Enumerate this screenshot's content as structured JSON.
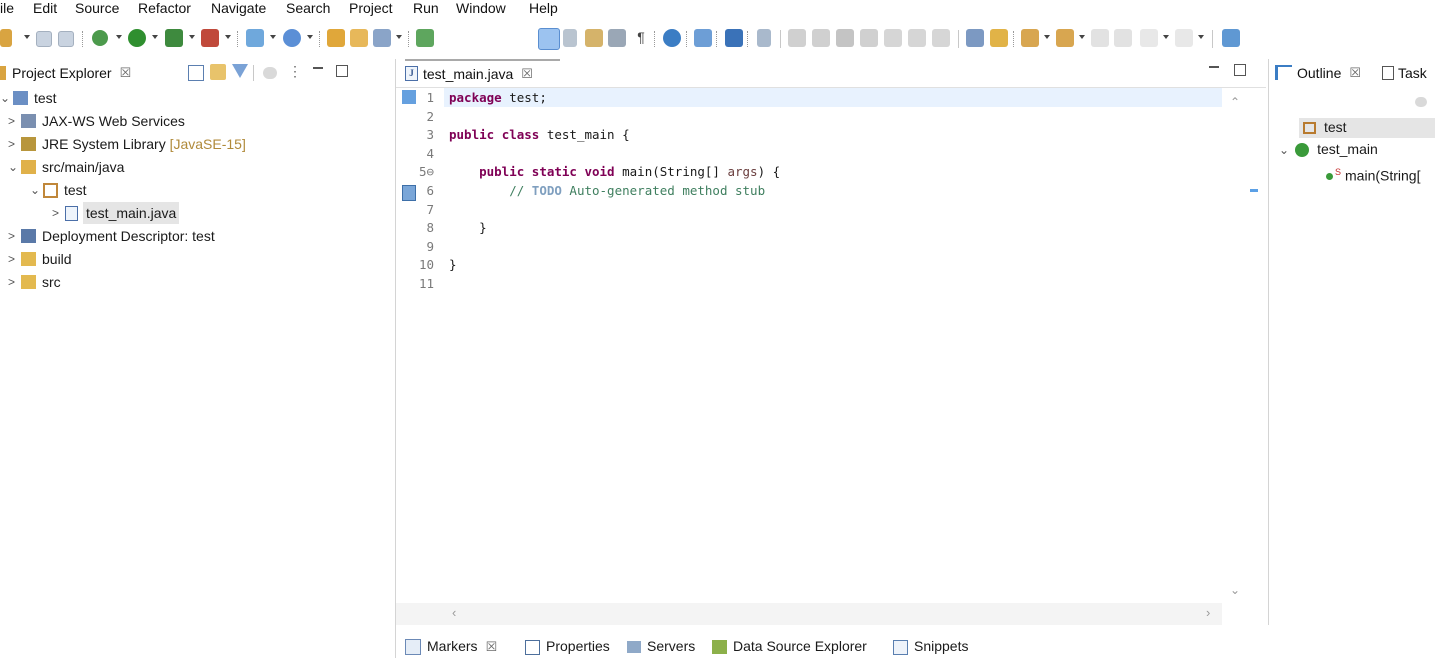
{
  "menu": [
    "ile",
    "Edit",
    "Source",
    "Refactor",
    "Navigate",
    "Search",
    "Project",
    "Run",
    "Window",
    "Help"
  ],
  "project_explorer": {
    "title": "Project Explorer",
    "close": "☒",
    "tree": [
      {
        "label": "test",
        "twisty": "⌄",
        "icon": "project-icon",
        "level": 0
      },
      {
        "label": "JAX-WS Web Services",
        "twisty": ">",
        "icon": "web-services-icon",
        "level": 1
      },
      {
        "label": "JRE System Library",
        "decoration": "[JavaSE-15]",
        "twisty": ">",
        "icon": "library-icon",
        "level": 1
      },
      {
        "label": "src/main/java",
        "twisty": "⌄",
        "icon": "source-folder-icon",
        "level": 1
      },
      {
        "label": "test",
        "twisty": "⌄",
        "icon": "package-icon",
        "level": 2
      },
      {
        "label": "test_main.java",
        "twisty": ">",
        "icon": "java-file-icon",
        "level": 3,
        "selected": true
      },
      {
        "label": "Deployment Descriptor: test",
        "twisty": ">",
        "icon": "deployment-descriptor-icon",
        "level": 1
      },
      {
        "label": "build",
        "twisty": ">",
        "icon": "folder-icon",
        "level": 1
      },
      {
        "label": "src",
        "twisty": ">",
        "icon": "folder-icon",
        "level": 1
      }
    ]
  },
  "editor": {
    "tab_label": "test_main.java",
    "close": "☒",
    "lines": [
      {
        "n": "1",
        "parts": [
          {
            "t": "package",
            "c": "kw"
          },
          {
            "t": " test;",
            "c": ""
          }
        ]
      },
      {
        "n": "2",
        "parts": []
      },
      {
        "n": "3",
        "parts": [
          {
            "t": "public",
            "c": "kw"
          },
          {
            "t": " ",
            "c": ""
          },
          {
            "t": "class",
            "c": "kw"
          },
          {
            "t": " test_main {",
            "c": ""
          }
        ]
      },
      {
        "n": "4",
        "parts": []
      },
      {
        "n": "5⊖",
        "parts": [
          {
            "t": "    ",
            "c": ""
          },
          {
            "t": "public",
            "c": "kw"
          },
          {
            "t": " ",
            "c": ""
          },
          {
            "t": "static",
            "c": "kw"
          },
          {
            "t": " ",
            "c": ""
          },
          {
            "t": "void",
            "c": "kw"
          },
          {
            "t": " main(String[] ",
            "c": ""
          },
          {
            "t": "args",
            "c": "ident"
          },
          {
            "t": ") {",
            "c": ""
          }
        ]
      },
      {
        "n": "6",
        "parts": [
          {
            "t": "        // ",
            "c": "cm"
          },
          {
            "t": "TODO",
            "c": "todo"
          },
          {
            "t": " Auto-generated method stub",
            "c": "cm"
          }
        ]
      },
      {
        "n": "7",
        "parts": []
      },
      {
        "n": "8",
        "parts": [
          {
            "t": "    }",
            "c": ""
          }
        ]
      },
      {
        "n": "9",
        "parts": []
      },
      {
        "n": "10",
        "parts": [
          {
            "t": "}",
            "c": ""
          }
        ]
      },
      {
        "n": "11",
        "parts": []
      }
    ]
  },
  "outline": {
    "title": "Outline",
    "close": "☒",
    "second_tab": "Task",
    "items": [
      {
        "label": "test",
        "icon": "package-icon"
      },
      {
        "label": "test_main",
        "icon": "class-icon",
        "twisty": "⌄"
      },
      {
        "label": "main(String[",
        "icon": "method-icon",
        "modifier": "S"
      }
    ]
  },
  "bottom_tabs": [
    {
      "label": "Markers",
      "icon": "markers-icon",
      "close": "☒"
    },
    {
      "label": "Properties",
      "icon": "properties-icon"
    },
    {
      "label": "Servers",
      "icon": "servers-icon"
    },
    {
      "label": "Data Source Explorer",
      "icon": "data-source-icon"
    },
    {
      "label": "Snippets",
      "icon": "snippets-icon"
    }
  ],
  "colors": {
    "keyword": "#7f0055",
    "comment": "#3f7f5f",
    "todo": "#7f9fbf",
    "line_highlight": "#e8f2fe",
    "selection": "#e5e5e5",
    "panel_border": "#d4d4d4",
    "tab_active_border": "#a9a9a9"
  }
}
